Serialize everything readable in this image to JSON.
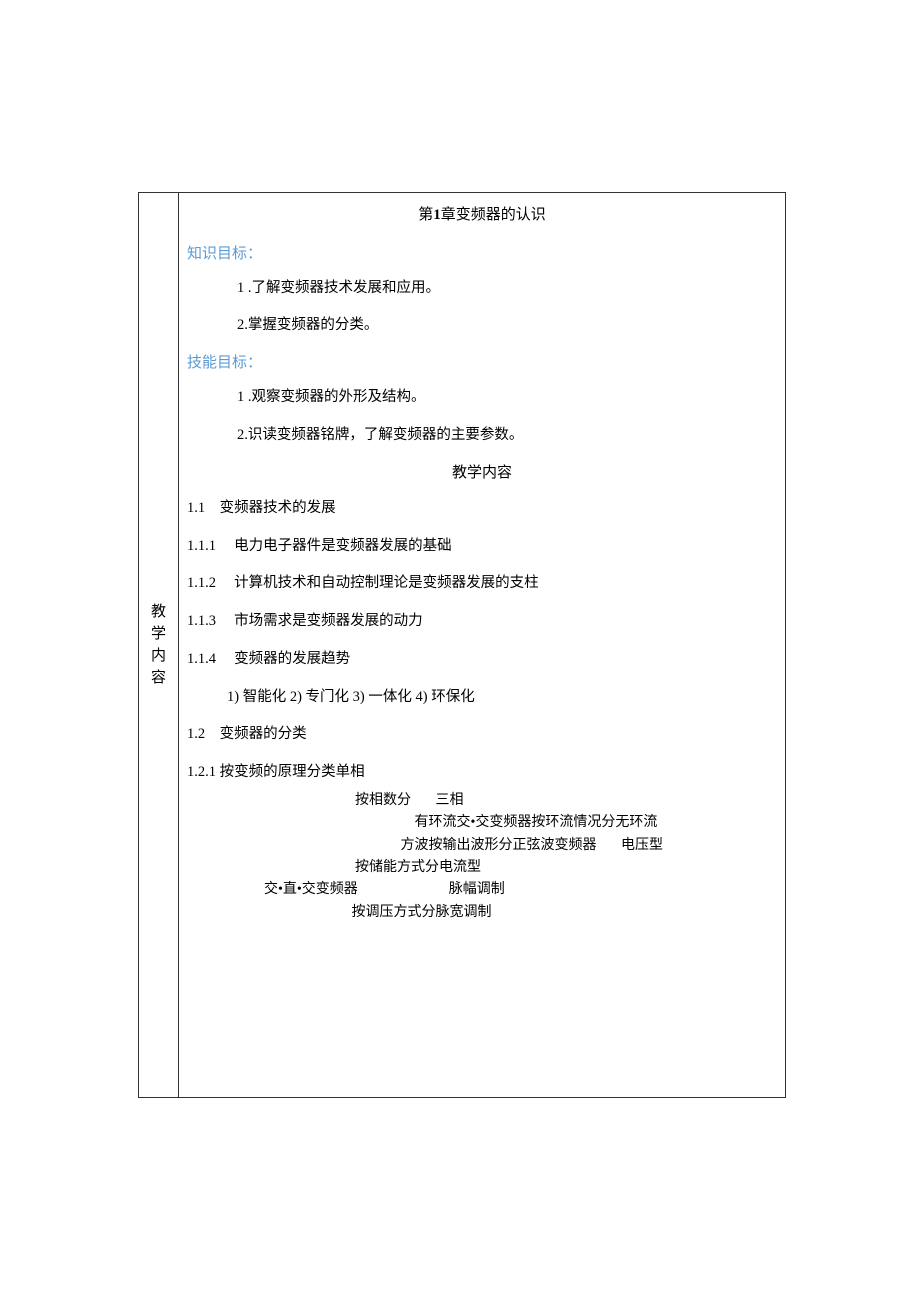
{
  "leftLabel": "教学内容",
  "title": {
    "prefix": "第",
    "bold": "1",
    "suffix": "章变频器的认识"
  },
  "knowledgeGoal": {
    "label": "知识目标：",
    "items": [
      "1 .了解变频器技术发展和应用。",
      "2.掌握变频器的分类。"
    ]
  },
  "skillGoal": {
    "label": "技能目标：",
    "items": [
      "1 .观察变频器的外形及结构。",
      "2.识读变频器铭牌，了解变频器的主要参数。"
    ]
  },
  "teachingContentLabel": "教学内容",
  "sections": [
    "1.1　变频器技术的发展",
    "1.1.1　  电力电子器件是变频器发展的基础",
    "1.1.2　  计算机技术和自动控制理论是变频器发展的支柱",
    "1.1.3　  市场需求是变频器发展的动力",
    "1.1.4　  变频器的发展趋势"
  ],
  "trend": "1)  智能化 2)  专门化 3)  一体化 4)  环保化",
  "section12": "1.2　变频器的分类",
  "section121": "1.2.1  按变频的原理分类单相",
  "diagram": {
    "line1": "                                                按相数分       三相",
    "line2": "                                                                 有环流交•交变频器按环流情况分无环流",
    "line3": "                                                             方波按输出波形分正弦波变频器       电压型",
    "line4": "                                                按储能方式分电流型",
    "line5": "                      交•直•交变频器                          脉幅调制",
    "line6": "                                               按调压方式分脉宽调制"
  }
}
